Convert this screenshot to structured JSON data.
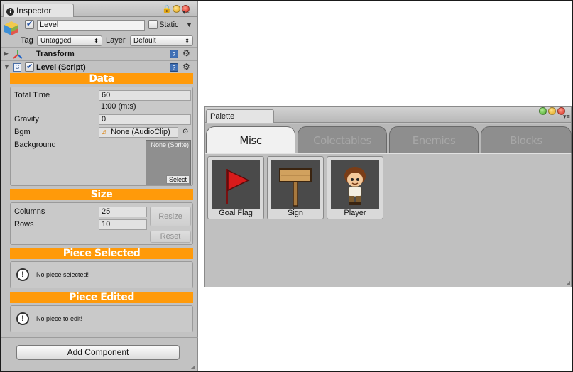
{
  "inspector": {
    "tab_label": "Inspector",
    "object_name": "Level",
    "static_label": "Static",
    "tag_label": "Tag",
    "tag_value": "Untagged",
    "layer_label": "Layer",
    "layer_value": "Default",
    "components": [
      {
        "title": "Transform",
        "expanded": false
      },
      {
        "title": "Level (Script)",
        "expanded": true
      }
    ],
    "sections": {
      "data": {
        "title": "Data",
        "total_time_label": "Total Time",
        "total_time_value": "60",
        "total_time_readout": "1:00 (m:s)",
        "gravity_label": "Gravity",
        "gravity_value": "0",
        "bgm_label": "Bgm",
        "bgm_value": "None (AudioClip)",
        "background_label": "Background",
        "background_value": "None (Sprite)",
        "select_label": "Select"
      },
      "size": {
        "title": "Size",
        "columns_label": "Columns",
        "columns_value": "25",
        "rows_label": "Rows",
        "rows_value": "10",
        "resize_label": "Resize",
        "reset_label": "Reset"
      },
      "piece_selected": {
        "title": "Piece Selected",
        "message": "No piece selected!"
      },
      "piece_edited": {
        "title": "Piece Edited",
        "message": "No piece to edit!"
      }
    },
    "add_component_label": "Add Component"
  },
  "palette": {
    "tab_label": "Palette",
    "categories": [
      {
        "label": "Misc",
        "active": true
      },
      {
        "label": "Colectables",
        "active": false
      },
      {
        "label": "Enemies",
        "active": false
      },
      {
        "label": "Blocks",
        "active": false
      }
    ],
    "items": [
      {
        "label": "Goal Flag",
        "icon": "red-flag-icon"
      },
      {
        "label": "Sign",
        "icon": "wooden-sign-icon"
      },
      {
        "label": "Player",
        "icon": "player-character-icon"
      }
    ]
  },
  "colors": {
    "section_header": "#ff9a0a",
    "panel_bg": "#c2c2c2",
    "thumb_bg": "#4a4a4a"
  }
}
